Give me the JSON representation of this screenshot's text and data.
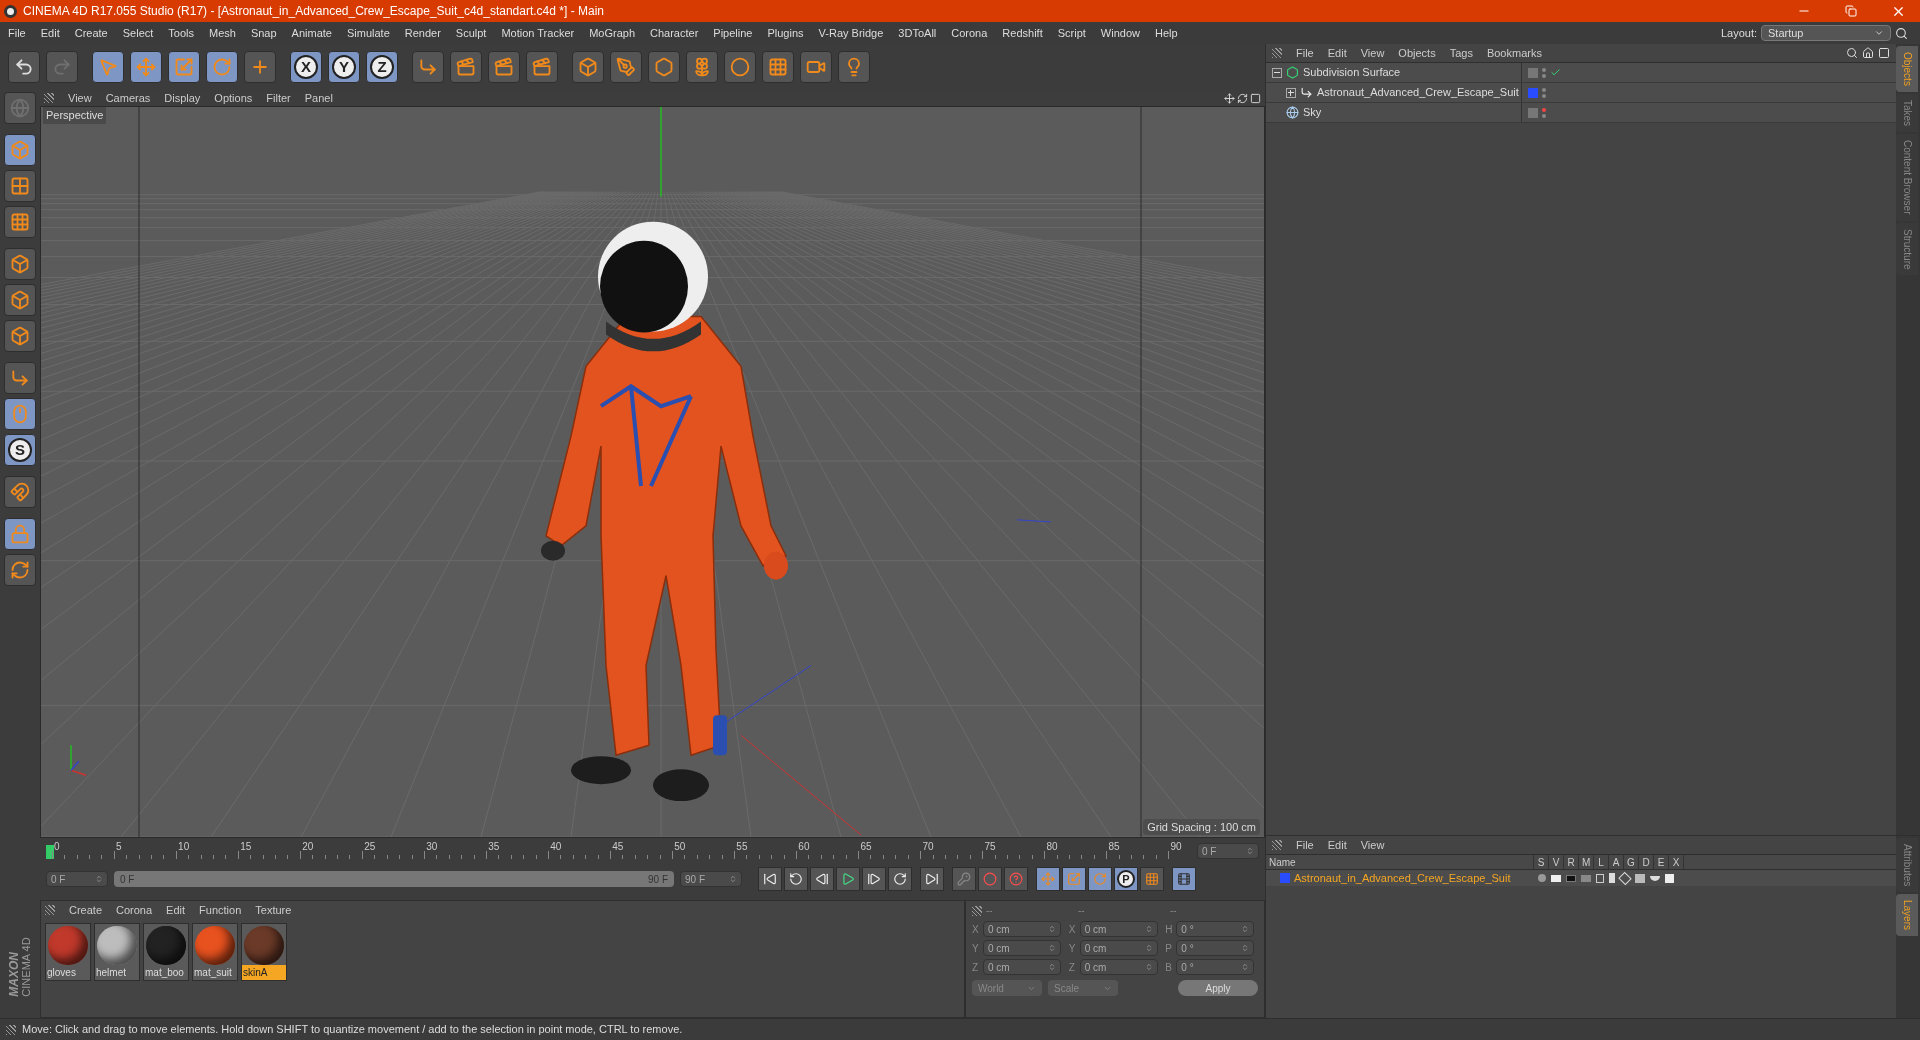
{
  "window": {
    "title": "CINEMA 4D R17.055 Studio (R17) - [Astronaut_in_Advanced_Crew_Escape_Suit_c4d_standart.c4d *] - Main"
  },
  "menu": [
    "File",
    "Edit",
    "Create",
    "Select",
    "Tools",
    "Mesh",
    "Snap",
    "Animate",
    "Simulate",
    "Render",
    "Sculpt",
    "Motion Tracker",
    "MoGraph",
    "Character",
    "Pipeline",
    "Plugins",
    "V-Ray Bridge",
    "3DToAll",
    "Corona",
    "Redshift",
    "Script",
    "Window",
    "Help"
  ],
  "layout": {
    "label": "Layout:",
    "value": "Startup"
  },
  "toolbar": [
    {
      "kind": "undo",
      "selected": false,
      "disabled": false
    },
    {
      "kind": "redo",
      "selected": false,
      "disabled": true
    },
    {
      "kind": "select",
      "selected": true,
      "disabled": false
    },
    {
      "kind": "move",
      "selected": true,
      "disabled": false
    },
    {
      "kind": "scale",
      "selected": true,
      "disabled": false
    },
    {
      "kind": "rotate",
      "selected": true,
      "disabled": false
    },
    {
      "kind": "add",
      "selected": false,
      "disabled": false
    },
    {
      "kind": "axis",
      "label": "X",
      "selected": true,
      "disabled": false
    },
    {
      "kind": "axis",
      "label": "Y",
      "selected": true,
      "disabled": false
    },
    {
      "kind": "axis",
      "label": "Z",
      "selected": true,
      "disabled": false
    },
    {
      "kind": "coords",
      "selected": false,
      "disabled": false
    },
    {
      "kind": "render-view",
      "selected": false,
      "disabled": false
    },
    {
      "kind": "render-picture",
      "selected": false,
      "disabled": false
    },
    {
      "kind": "render-settings",
      "selected": false,
      "disabled": false
    },
    {
      "kind": "cube",
      "selected": false,
      "disabled": false
    },
    {
      "kind": "pen",
      "selected": false,
      "disabled": false
    },
    {
      "kind": "subdivision",
      "selected": false,
      "disabled": false
    },
    {
      "kind": "cloner",
      "selected": false,
      "disabled": false
    },
    {
      "kind": "deformer",
      "selected": false,
      "disabled": false
    },
    {
      "kind": "floor",
      "selected": false,
      "disabled": false
    },
    {
      "kind": "camera",
      "selected": false,
      "disabled": false
    },
    {
      "kind": "light",
      "selected": false,
      "disabled": false
    }
  ],
  "left_tools": [
    {
      "kind": "globe",
      "selected": false,
      "disabled": true
    },
    {
      "kind": "model",
      "selected": true,
      "disabled": false
    },
    {
      "kind": "texture",
      "selected": false,
      "disabled": false
    },
    {
      "kind": "workplane",
      "selected": false,
      "disabled": false
    },
    {
      "kind": "points",
      "selected": false,
      "disabled": false
    },
    {
      "kind": "edges",
      "selected": false,
      "disabled": false
    },
    {
      "kind": "polygons",
      "selected": false,
      "disabled": false
    },
    {
      "kind": "axis",
      "selected": false,
      "disabled": false
    },
    {
      "kind": "tweak",
      "selected": true,
      "disabled": false
    },
    {
      "kind": "snap",
      "label": "S",
      "selected": true,
      "disabled": false
    },
    {
      "kind": "magnet",
      "selected": false,
      "disabled": false
    },
    {
      "kind": "grid-lock",
      "selected": true,
      "disabled": false
    },
    {
      "kind": "grid-rotate",
      "selected": false,
      "disabled": false
    }
  ],
  "logo": {
    "brand": "MAXON",
    "product": "CINEMA 4D"
  },
  "viewport": {
    "menu": [
      "View",
      "Cameras",
      "Display",
      "Options",
      "Filter",
      "Panel"
    ],
    "camera": "Perspective",
    "grid_spacing": "Grid Spacing : 100 cm"
  },
  "timeline": {
    "ticks": [
      "0",
      "5",
      "10",
      "15",
      "20",
      "25",
      "30",
      "35",
      "40",
      "45",
      "50",
      "55",
      "60",
      "65",
      "70",
      "75",
      "80",
      "85",
      "90"
    ],
    "playhead": {
      "level": 0
    },
    "current": "0 F",
    "start": "0 F",
    "range": {
      "level": 1
    },
    "range_start": "0 F",
    "range_end": "90 F",
    "end": "90 F",
    "keys": [
      {
        "kind": "move",
        "selected": true
      },
      {
        "kind": "scale",
        "selected": true
      },
      {
        "kind": "rotate",
        "selected": true
      },
      {
        "kind": "param",
        "label": "P",
        "selected": true
      },
      {
        "kind": "grid",
        "selected": false
      }
    ]
  },
  "materials": {
    "menu": [
      "Create",
      "Corona",
      "Edit",
      "Function",
      "Texture"
    ],
    "items": [
      {
        "name": "gloves",
        "color": "#c0392b",
        "selected": false
      },
      {
        "name": "helmet",
        "color": "#bdbdbd",
        "selected": false
      },
      {
        "name": "mat_boo",
        "color": "#222222",
        "selected": false
      },
      {
        "name": "mat_suit",
        "color": "#e8521f",
        "selected": false
      },
      {
        "name": "skinA",
        "color": "#6b3a28",
        "selected": true
      }
    ]
  },
  "coordinates": {
    "columns": [
      {
        "header": "--",
        "rows": [
          {
            "axis": "X",
            "value": "0 cm"
          },
          {
            "axis": "Y",
            "value": "0 cm"
          },
          {
            "axis": "Z",
            "value": "0 cm"
          }
        ]
      },
      {
        "header": "--",
        "rows": [
          {
            "axis": "X",
            "value": "0 cm"
          },
          {
            "axis": "Y",
            "value": "0 cm"
          },
          {
            "axis": "Z",
            "value": "0 cm"
          }
        ]
      },
      {
        "header": "--",
        "rows": [
          {
            "axis": "H",
            "value": "0 °"
          },
          {
            "axis": "P",
            "value": "0 °"
          },
          {
            "axis": "B",
            "value": "0 °"
          }
        ]
      }
    ],
    "space": "World",
    "mode": "Scale",
    "apply": "Apply"
  },
  "status_bar": "Move: Click and drag to move elements. Hold down SHIFT to quantize movement / add to the selection in point mode, CTRL to remove.",
  "objects": {
    "menu": [
      "File",
      "Edit",
      "View",
      "Objects",
      "Tags",
      "Bookmarks"
    ],
    "tree": [
      {
        "name": "Subdivision Surface",
        "kind": "subdivision",
        "expanded": true,
        "enabled": true,
        "hidden": false,
        "children": [
          {
            "name": "Astronaut_Advanced_Crew_Escape_Suit",
            "kind": "null",
            "expanded": false,
            "enabled": false,
            "hidden": false,
            "color": "#2a4cff"
          }
        ]
      },
      {
        "name": "Sky",
        "kind": "sky",
        "enabled": false,
        "hidden": true
      }
    ]
  },
  "right_tabs": [
    {
      "label": "Objects",
      "selected": true
    },
    {
      "label": "Takes",
      "selected": false
    },
    {
      "label": "Content Browser",
      "selected": false
    },
    {
      "label": "Structure",
      "selected": false
    }
  ],
  "layers": {
    "menu": [
      "File",
      "Edit",
      "View"
    ],
    "columns": [
      "Name",
      "S",
      "V",
      "R",
      "M",
      "L",
      "A",
      "G",
      "D",
      "E",
      "X"
    ],
    "items": [
      {
        "name": "Astronaut_in_Advanced_Crew_Escape_Suit",
        "color": "#2a4cff"
      }
    ]
  },
  "bottom_tabs": [
    {
      "label": "Attributes",
      "selected": false
    },
    {
      "label": "Layers",
      "selected": true
    }
  ]
}
